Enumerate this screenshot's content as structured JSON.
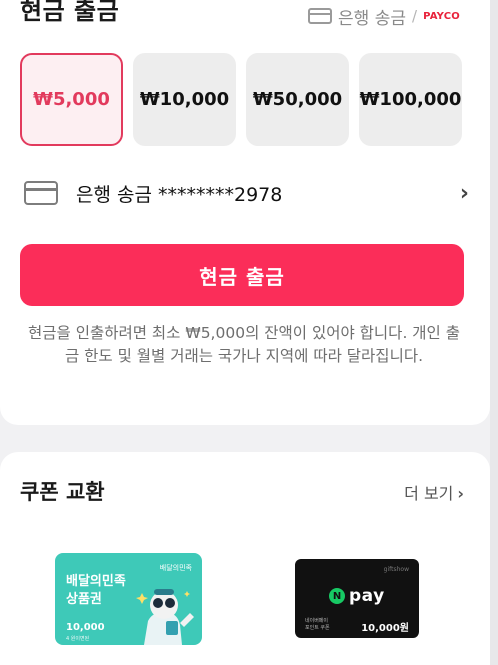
{
  "withdraw": {
    "title": "현금 출금",
    "method_label": "은행 송금",
    "separator": "/",
    "payco_label": "PAYCO",
    "amounts": [
      {
        "label": "₩5,000",
        "selected": true
      },
      {
        "label": "₩10,000",
        "selected": false
      },
      {
        "label": "₩50,000",
        "selected": false
      },
      {
        "label": "₩100,000",
        "selected": false
      }
    ],
    "bank_account": "은행 송금 ********2978",
    "button_label": "현금 출금",
    "notice": "현금을 인출하려면 최소 ₩5,000의 잔액이 있어야 합니다. 개인 출금 한도 및 월별 거래는 국가나 지역에 따라 달라집니다.",
    "accent_color": "#fb2d59"
  },
  "coupons": {
    "title": "쿠폰 교환",
    "more_label": "더 보기",
    "more_chevron": "›",
    "items": [
      {
        "brand_small": "배달의민족",
        "line1": "배달의민족",
        "line2": "상품권",
        "value": "10,000",
        "sub": "4 원이면된",
        "color": "#3ec9b8"
      },
      {
        "giftshow": "giftshow",
        "logo_letter": "N",
        "logo_text": "pay",
        "small1": "네이버페이",
        "small2": "포인트 쿠폰",
        "price": "10,000원",
        "color": "#111111"
      }
    ]
  }
}
